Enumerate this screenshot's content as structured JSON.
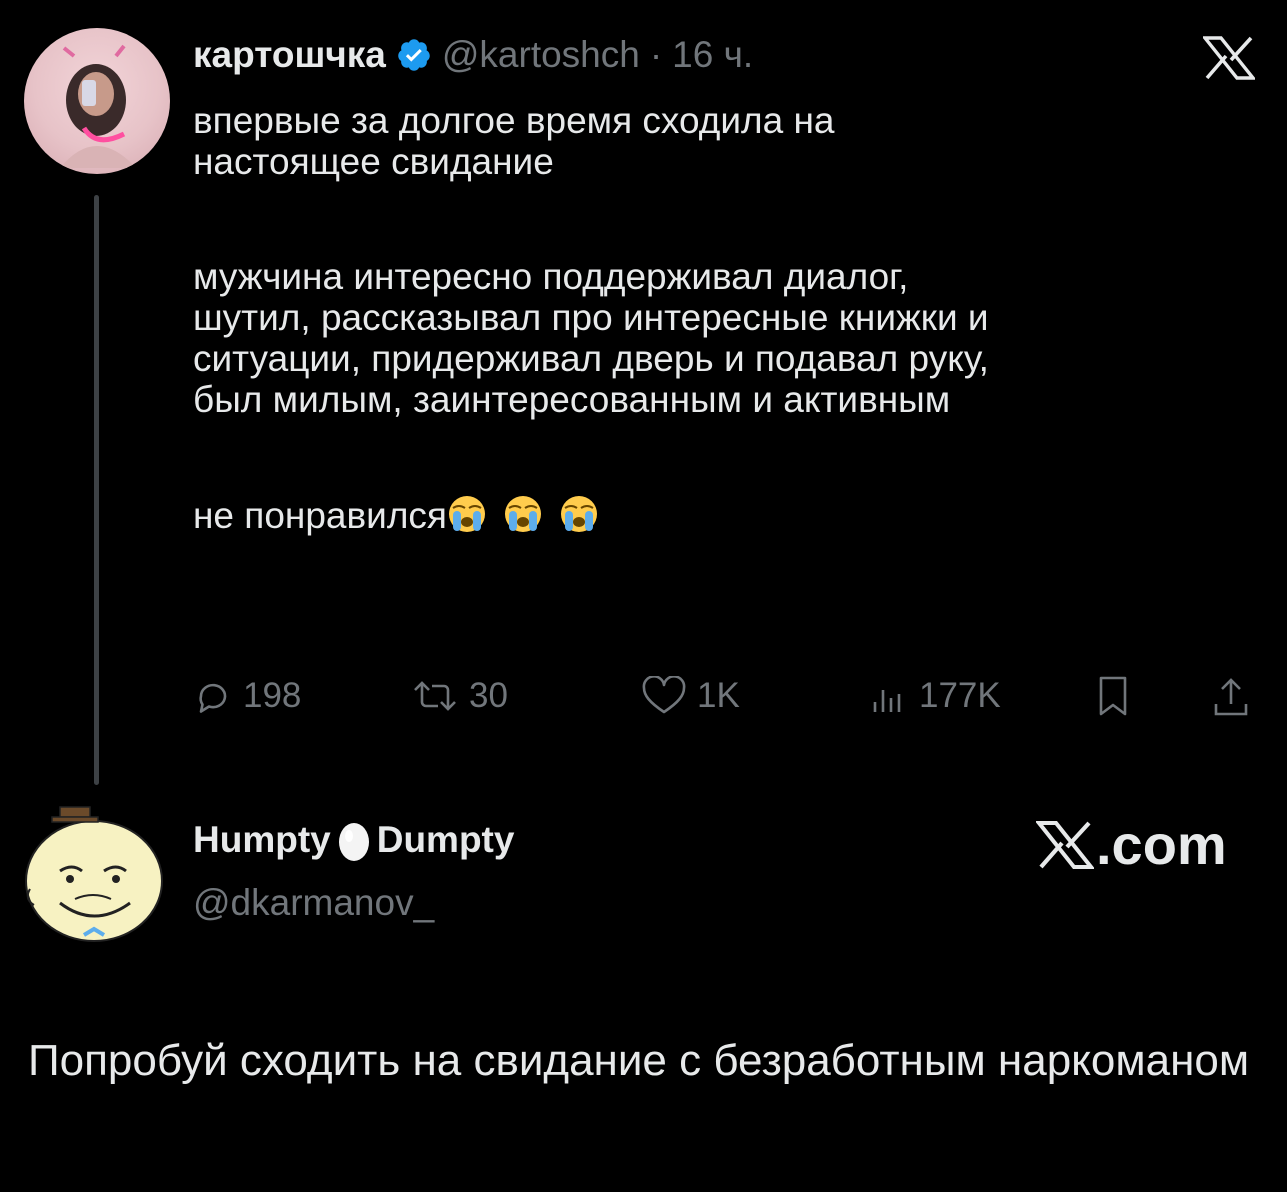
{
  "tweet": {
    "author_name": "картошчка",
    "handle": "@kartoshch",
    "separator": "·",
    "time": "16 ч.",
    "text_lines_1": [
      "впервые за долгое время сходила на",
      "настоящее свидание"
    ],
    "text_lines_2": [
      "мужчина интересно поддерживал диалог,",
      "шутил, рассказывал про интересные книжки и",
      "ситуации, придерживал дверь и подавал руку,",
      "был милым, заинтересованным и активным"
    ],
    "text_line_3": "не понравился",
    "emoji": [
      "loudly-crying-face",
      "loudly-crying-face",
      "loudly-crying-face"
    ],
    "stats": {
      "replies": "198",
      "retweets": "30",
      "likes": "1K",
      "views": "177K"
    },
    "icons": [
      "reply-icon",
      "retweet-icon",
      "like-icon",
      "views-icon",
      "bookmark-icon",
      "share-icon"
    ]
  },
  "reply": {
    "author_name_part1": "Humpty",
    "author_name_part2": "Dumpty",
    "handle": "@dkarmanov_",
    "brand": ".com",
    "text": "Попробуй сходить на свидание с безработным наркоманом"
  },
  "colors": {
    "background": "#000000",
    "text": "#e7e9ea",
    "muted": "#71767b",
    "verified": "#1d9bf0",
    "thread_line": "#3d4145"
  }
}
